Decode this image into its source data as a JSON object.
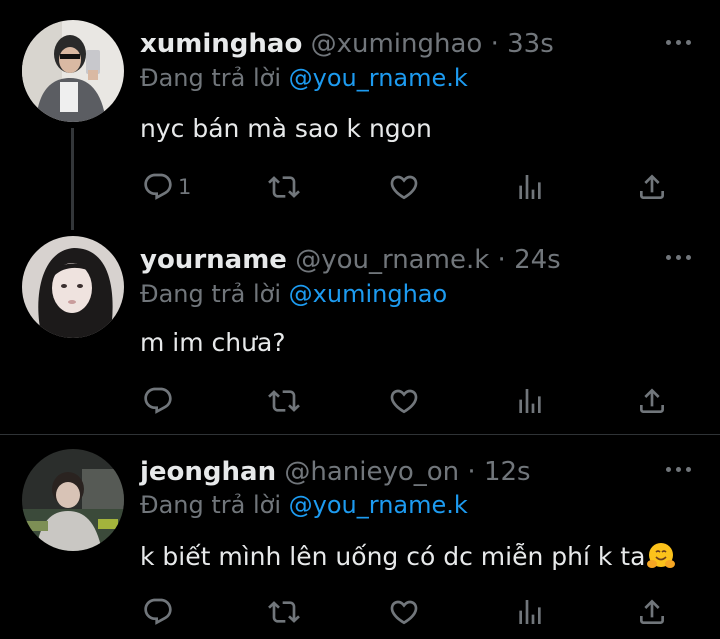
{
  "tweets": [
    {
      "display_name": "xuminghao",
      "handle": "@xuminghao",
      "separator": "·",
      "time": "33s",
      "reply_prefix": "Đang trả lời",
      "reply_to": "@you_rname.k",
      "text": "nyc bán mà sao k ngon",
      "reply_count": "1"
    },
    {
      "display_name": "yourname",
      "handle": "@you_rname.k",
      "separator": "·",
      "time": "24s",
      "reply_prefix": "Đang trả lời",
      "reply_to": "@xuminghao",
      "text": "m im chưa?",
      "reply_count": ""
    },
    {
      "display_name": "jeonghan",
      "handle": "@hanieyo_on",
      "separator": "·",
      "time": "12s",
      "reply_prefix": "Đang trả lời",
      "reply_to": "@you_rname.k",
      "text": "k biết mình lên uống có dc miễn phí k ta",
      "text_emoji": "hugging-face-emoji",
      "reply_count": ""
    }
  ],
  "icons": {
    "reply": "reply-icon",
    "retweet": "retweet-icon",
    "like": "heart-icon",
    "views": "analytics-icon",
    "share": "share-icon",
    "more": "more-icon"
  },
  "colors": {
    "background": "#000000",
    "primary_text": "#e7e9ea",
    "secondary_text": "#71767b",
    "mention": "#1d9bf0",
    "divider": "#2f3336"
  }
}
